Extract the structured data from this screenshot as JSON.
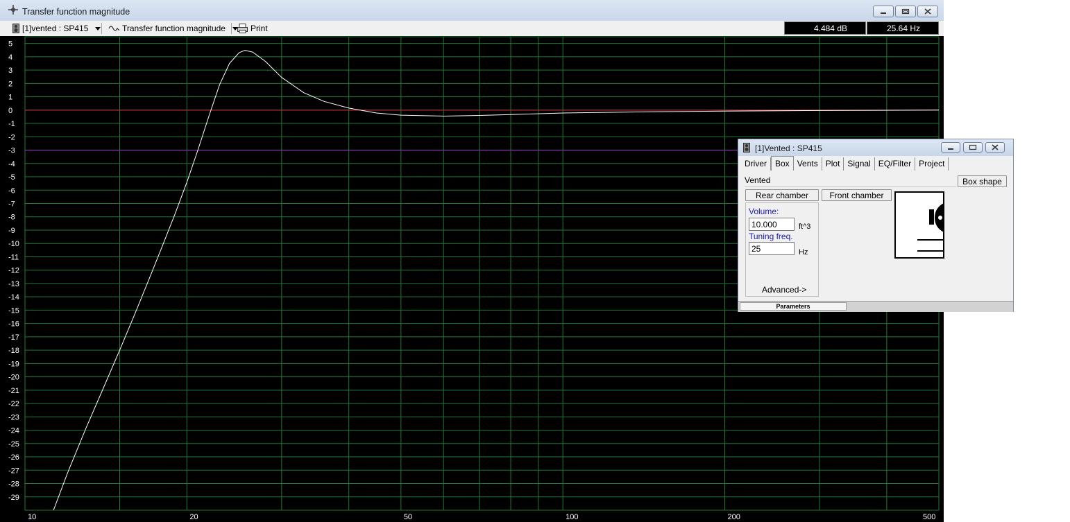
{
  "window": {
    "title": "Transfer function magnitude"
  },
  "toolbar": {
    "project_select": "[1]vented : SP415",
    "plot_select": "Transfer function magnitude",
    "print_label": "Print"
  },
  "readouts": {
    "db": "4.484 dB",
    "hz": "25.64 Hz"
  },
  "chart_data": {
    "type": "line",
    "x_scale": "log",
    "xlim": [
      10,
      500
    ],
    "ylim": [
      -30,
      5.5
    ],
    "x_ticks": [
      10,
      20,
      50,
      100,
      200,
      500
    ],
    "x_tick_labels": [
      "10",
      "20",
      "50",
      "100",
      "200",
      "500"
    ],
    "x_grid": [
      10,
      15,
      20,
      30,
      40,
      50,
      60,
      70,
      80,
      90,
      100,
      200,
      300,
      400,
      500
    ],
    "y_ticks": [
      5,
      4,
      3,
      2,
      1,
      0,
      -1,
      -2,
      -3,
      -4,
      -5,
      -6,
      -7,
      -8,
      -9,
      -10,
      -11,
      -12,
      -13,
      -14,
      -15,
      -16,
      -17,
      -18,
      -19,
      -20,
      -21,
      -22,
      -23,
      -24,
      -25,
      -26,
      -27,
      -28,
      -29
    ],
    "y_tick_labels": [
      "5",
      "4",
      "3",
      "2",
      "1",
      "0",
      "-1",
      "-2",
      "-3",
      "-4",
      "-5",
      "-6",
      "-7",
      "-8",
      "-9",
      "-10",
      "-11",
      "-12",
      "-13",
      "-14",
      "-15",
      "-16",
      "-17",
      "-18",
      "-19",
      "-20",
      "-21",
      "-22",
      "-23",
      "-24",
      "-25",
      "-26",
      "-27",
      "-28",
      "-29"
    ],
    "grid": true,
    "reference_lines": [
      {
        "y": 0,
        "color": "#d0303a"
      },
      {
        "y": -3,
        "color": "#a63ad0"
      }
    ],
    "colors": {
      "background": "#000000",
      "grid": "#1f7a34",
      "curve": "#ffffff"
    },
    "series": [
      {
        "x": [
          11.3,
          12,
          13,
          14,
          15,
          16,
          17,
          18,
          19,
          20,
          21,
          22,
          23,
          24,
          25,
          25.64,
          26.5,
          28,
          30,
          33,
          36,
          40,
          45,
          50,
          60,
          70,
          80,
          100,
          150,
          200,
          300,
          500
        ],
        "y": [
          -30,
          -27.2,
          -23.8,
          -20.8,
          -18,
          -15.3,
          -12.7,
          -10.2,
          -7.8,
          -5.4,
          -2.9,
          -0.4,
          1.9,
          3.5,
          4.3,
          4.48,
          4.35,
          3.65,
          2.45,
          1.3,
          0.65,
          0.15,
          -0.22,
          -0.38,
          -0.45,
          -0.4,
          -0.33,
          -0.22,
          -0.12,
          -0.07,
          -0.03,
          0
        ]
      }
    ]
  },
  "dialog": {
    "title": "[1]Vented : SP415",
    "tabs": [
      "Driver",
      "Box",
      "Vents",
      "Plot",
      "Signal",
      "EQ/Filter",
      "Project"
    ],
    "active_tab": "Box",
    "box_type": "Vented",
    "box_shape_button": "Box shape",
    "rear_chamber_button": "Rear chamber",
    "front_chamber_button": "Front chamber",
    "volume_label": "Volume:",
    "volume_value": "10.000",
    "volume_unit": "ft^3",
    "tuning_label": "Tuning freq.",
    "tuning_value": "25",
    "tuning_unit": "Hz",
    "advanced_button": "Advanced->",
    "status_tab": "Parameters"
  }
}
